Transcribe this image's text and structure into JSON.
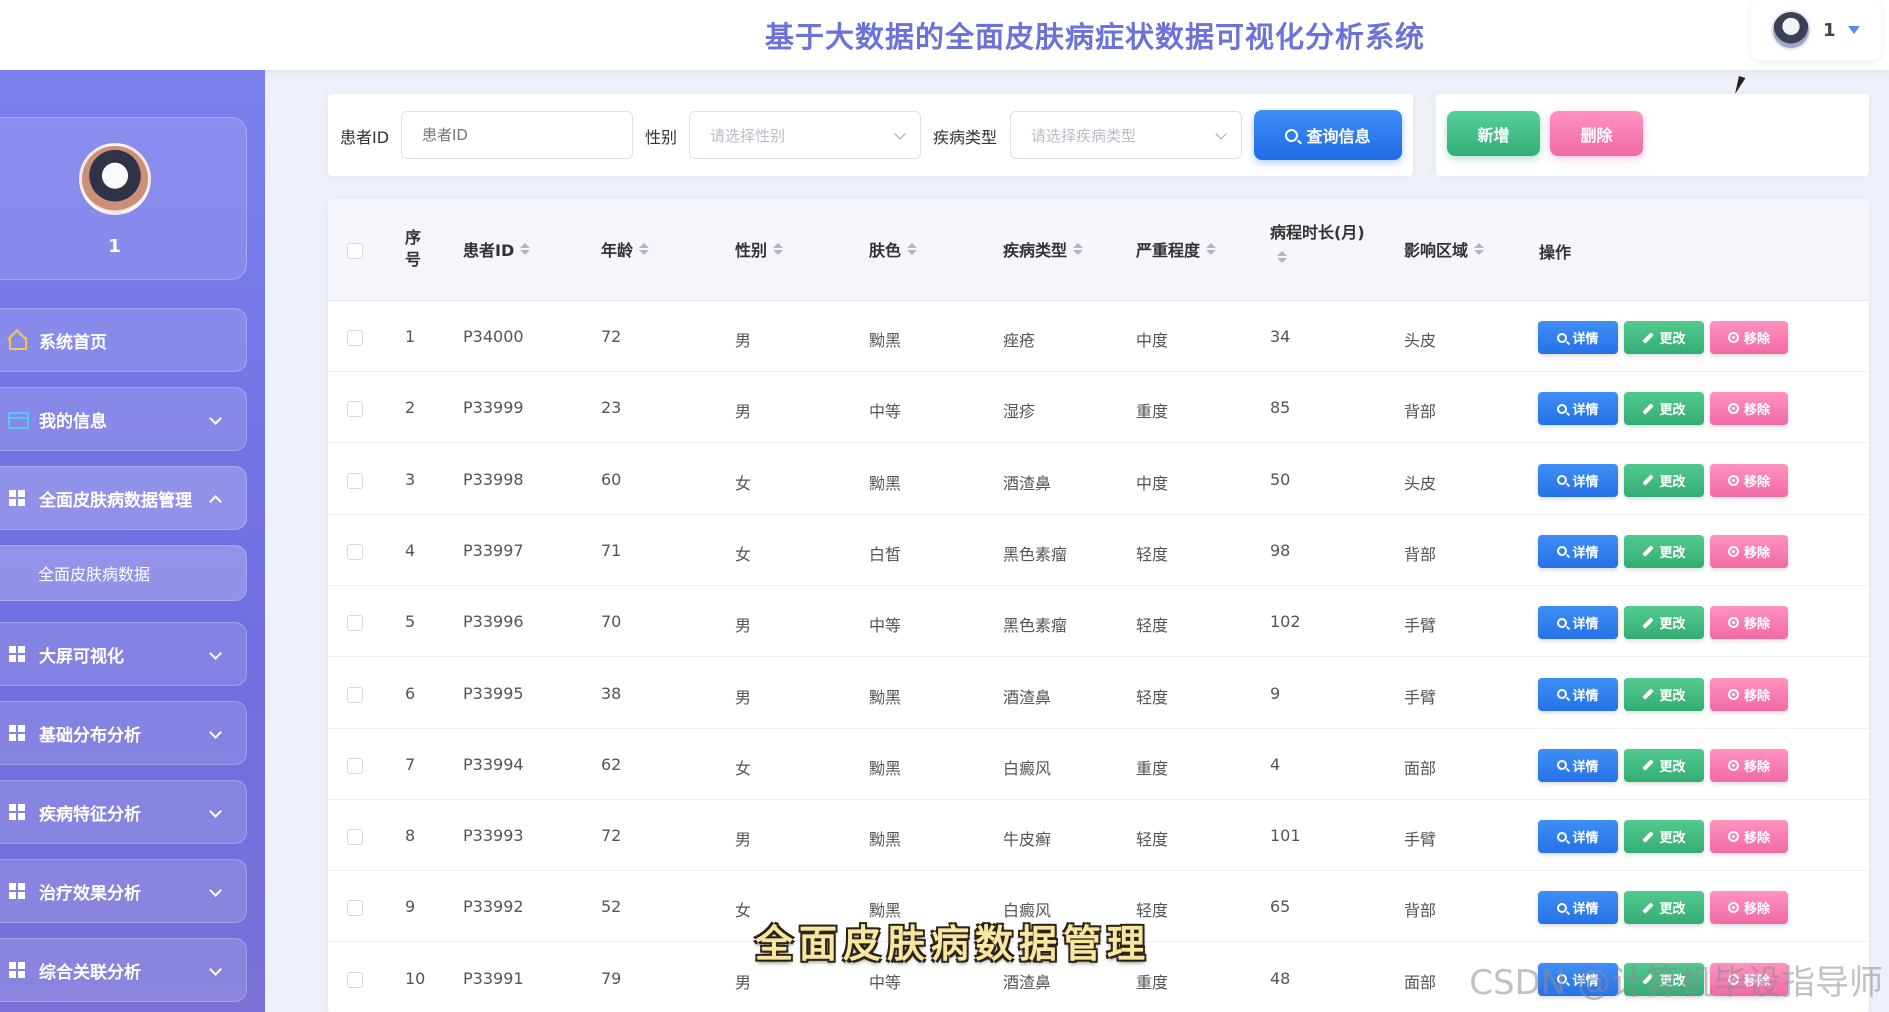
{
  "header": {
    "title": "基于大数据的全面皮肤病症状数据可视化分析系统",
    "user_name": "1"
  },
  "sidebar": {
    "profile_name": "1",
    "items": [
      {
        "label": "系统首页",
        "icon": "home-icon"
      },
      {
        "label": "我的信息",
        "icon": "card-icon"
      },
      {
        "label": "全面皮肤病数据管理",
        "icon": "grid-icon"
      },
      {
        "label": "全面皮肤病数据",
        "icon": ""
      },
      {
        "label": "大屏可视化",
        "icon": "grid-icon"
      },
      {
        "label": "基础分布分析",
        "icon": "grid-icon"
      },
      {
        "label": "疾病特征分析",
        "icon": "grid-icon"
      },
      {
        "label": "治疗效果分析",
        "icon": "grid-icon"
      },
      {
        "label": "综合关联分析",
        "icon": "grid-icon"
      }
    ]
  },
  "search": {
    "patient_id_label": "患者ID",
    "patient_id_placeholder": "患者ID",
    "gender_label": "性别",
    "gender_placeholder": "请选择性别",
    "disease_label": "疾病类型",
    "disease_placeholder": "请选择疾病类型",
    "search_button": "查询信息"
  },
  "actions": {
    "add": "新增",
    "delete": "删除"
  },
  "table": {
    "columns": [
      "序号",
      "患者ID",
      "年龄",
      "性别",
      "肤色",
      "疾病类型",
      "严重程度",
      "病程时长(月)",
      "影响区域",
      "操作"
    ],
    "row_buttons": {
      "view": "详情",
      "edit": "更改",
      "remove": "移除"
    },
    "rows": [
      [
        "1",
        "P34000",
        "72",
        "男",
        "黝黑",
        "痤疮",
        "中度",
        "34",
        "头皮"
      ],
      [
        "2",
        "P33999",
        "23",
        "男",
        "中等",
        "湿疹",
        "重度",
        "85",
        "背部"
      ],
      [
        "3",
        "P33998",
        "60",
        "女",
        "黝黑",
        "酒渣鼻",
        "中度",
        "50",
        "头皮"
      ],
      [
        "4",
        "P33997",
        "71",
        "女",
        "白皙",
        "黑色素瘤",
        "轻度",
        "98",
        "背部"
      ],
      [
        "5",
        "P33996",
        "70",
        "男",
        "中等",
        "黑色素瘤",
        "轻度",
        "102",
        "手臂"
      ],
      [
        "6",
        "P33995",
        "38",
        "男",
        "黝黑",
        "酒渣鼻",
        "轻度",
        "9",
        "手臂"
      ],
      [
        "7",
        "P33994",
        "62",
        "女",
        "黝黑",
        "白癜风",
        "重度",
        "4",
        "面部"
      ],
      [
        "8",
        "P33993",
        "72",
        "男",
        "黝黑",
        "牛皮癣",
        "轻度",
        "101",
        "手臂"
      ],
      [
        "9",
        "P33992",
        "52",
        "女",
        "黝黑",
        "白癜风",
        "轻度",
        "65",
        "背部"
      ],
      [
        "10",
        "P33991",
        "79",
        "男",
        "中等",
        "酒渣鼻",
        "重度",
        "48",
        "面部"
      ]
    ]
  },
  "overlay": {
    "caption": "全面皮肤病数据管理",
    "watermark": "CSDN @计算机毕设指导师"
  },
  "colors": {
    "primary": "#2672e8",
    "success": "#34ad74",
    "danger": "#f06aa3",
    "sidebar": "#7c80ee",
    "title": "#6b72d8"
  }
}
